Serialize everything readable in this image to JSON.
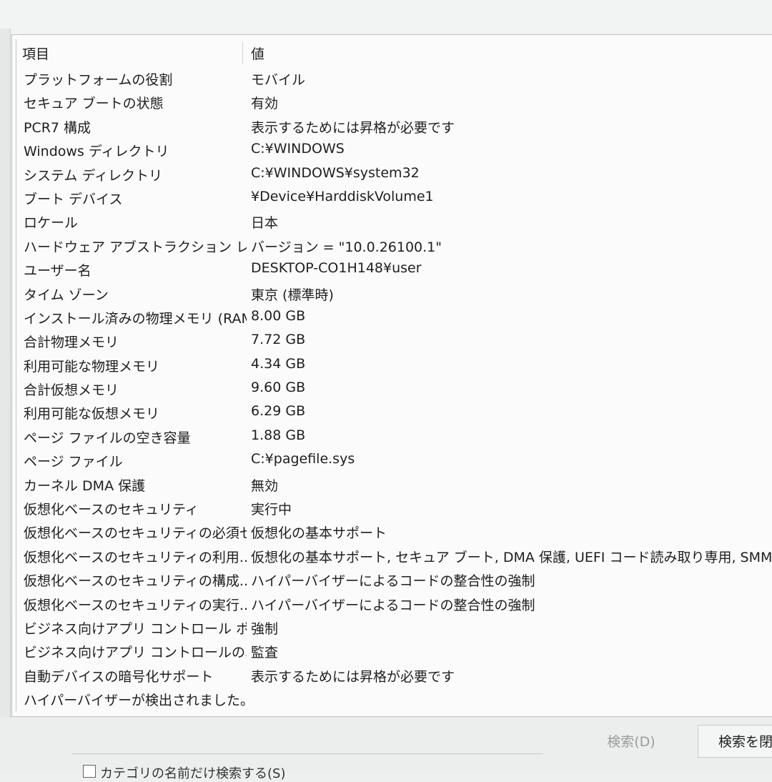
{
  "header": {
    "col_item": "項目",
    "col_value": "値"
  },
  "rows": [
    {
      "item": "プラットフォームの役割",
      "value": "モバイル"
    },
    {
      "item": "セキュア ブートの状態",
      "value": "有効"
    },
    {
      "item": "PCR7 構成",
      "value": "表示するためには昇格が必要です"
    },
    {
      "item": "Windows ディレクトリ",
      "value": "C:¥WINDOWS"
    },
    {
      "item": "システム ディレクトリ",
      "value": "C:¥WINDOWS¥system32"
    },
    {
      "item": "ブート デバイス",
      "value": "¥Device¥HarddiskVolume1"
    },
    {
      "item": "ロケール",
      "value": "日本"
    },
    {
      "item": "ハードウェア アブストラクション レイヤー",
      "value": "バージョン = \"10.0.26100.1\""
    },
    {
      "item": "ユーザー名",
      "value": "DESKTOP-CO1H148¥user"
    },
    {
      "item": "タイム ゾーン",
      "value": "東京 (標準時)"
    },
    {
      "item": "インストール済みの物理メモリ (RAM)",
      "value": "8.00 GB"
    },
    {
      "item": "合計物理メモリ",
      "value": "7.72 GB"
    },
    {
      "item": "利用可能な物理メモリ",
      "value": "4.34 GB"
    },
    {
      "item": "合計仮想メモリ",
      "value": "9.60 GB"
    },
    {
      "item": "利用可能な仮想メモリ",
      "value": "6.29 GB"
    },
    {
      "item": "ページ ファイルの空き容量",
      "value": "1.88 GB"
    },
    {
      "item": "ページ ファイル",
      "value": "C:¥pagefile.sys"
    },
    {
      "item": "カーネル DMA 保護",
      "value": "無効"
    },
    {
      "item": "仮想化ベースのセキュリティ",
      "value": "実行中"
    },
    {
      "item": "仮想化ベースのセキュリティの必須セ...",
      "value": "仮想化の基本サポート"
    },
    {
      "item": "仮想化ベースのセキュリティの利用...",
      "value": "仮想化の基本サポート, セキュア ブート, DMA 保護, UEFI コード読み取り専用, SMM Se..."
    },
    {
      "item": "仮想化ベースのセキュリティの構成...",
      "value": "ハイパーバイザーによるコードの整合性の強制"
    },
    {
      "item": "仮想化ベースのセキュリティの実行...",
      "value": "ハイパーバイザーによるコードの整合性の強制"
    },
    {
      "item": "ビジネス向けアプリ コントロール ポリ...",
      "value": "強制"
    },
    {
      "item": "ビジネス向けアプリ コントロールのユー...",
      "value": "監査"
    },
    {
      "item": "自動デバイスの暗号化サポート",
      "value": "表示するためには昇格が必要です"
    },
    {
      "item": "ハイパーバイザーが検出されました。H...",
      "value": ""
    }
  ],
  "footer": {
    "search_label": "検索(D)",
    "close_search_label": "検索を閉",
    "checkbox_label": "カテゴリの名前だけ検索する(S)"
  }
}
